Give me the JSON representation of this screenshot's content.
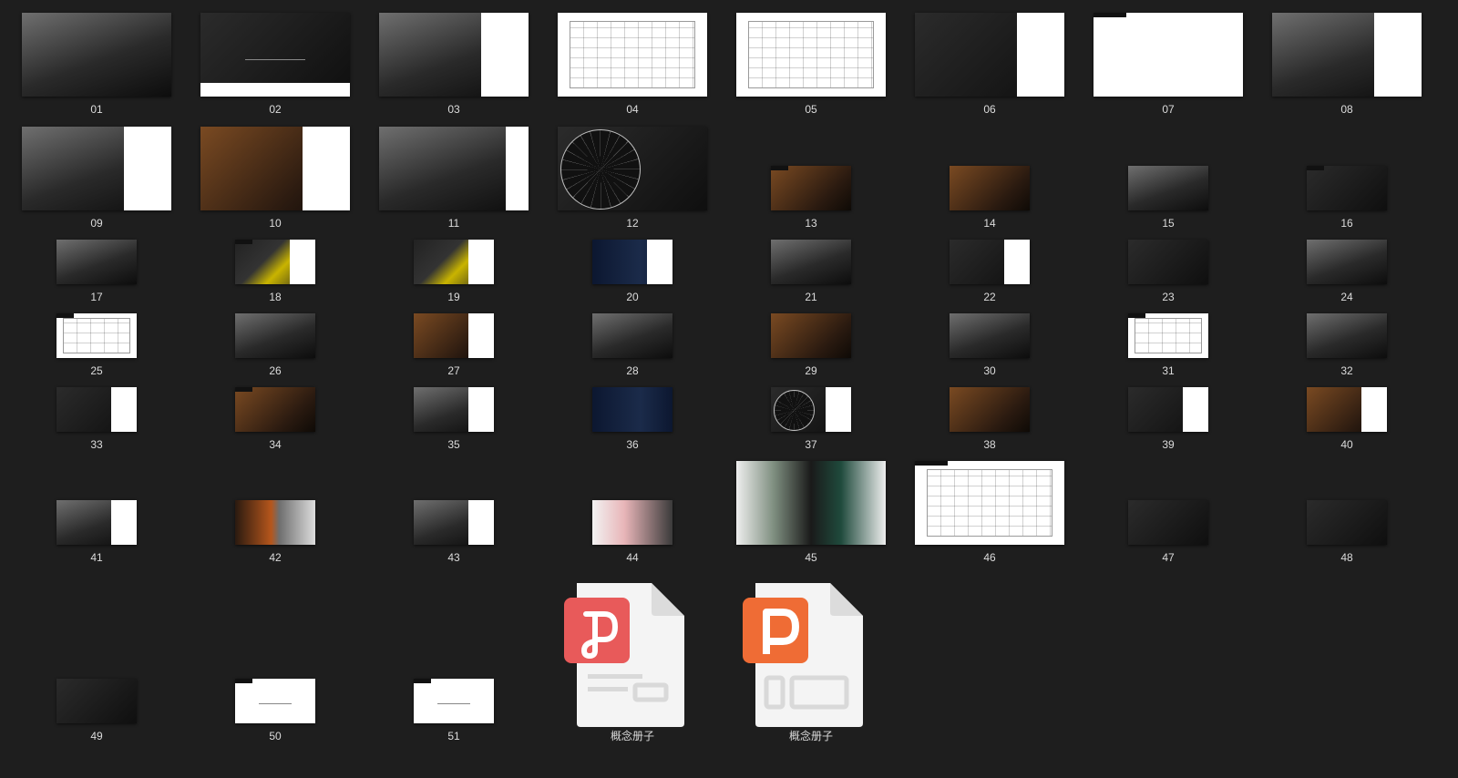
{
  "thumbnails": [
    {
      "label": "01",
      "style": "t-photo-bw",
      "size": "xl"
    },
    {
      "label": "02",
      "style": "t-dark",
      "size": "xl"
    },
    {
      "label": "03",
      "style": "t-photo-bw",
      "size": "xl"
    },
    {
      "label": "04",
      "style": "t-white",
      "size": "xl"
    },
    {
      "label": "05",
      "style": "t-white",
      "size": "xl"
    },
    {
      "label": "06",
      "style": "t-dark",
      "size": "xl"
    },
    {
      "label": "07",
      "style": "t-white",
      "size": "xl"
    },
    {
      "label": "08",
      "style": "t-photo-bw",
      "size": "xl"
    },
    {
      "label": "09",
      "style": "t-photo-bw",
      "size": "xl"
    },
    {
      "label": "10",
      "style": "t-warm",
      "size": "xl"
    },
    {
      "label": "11",
      "style": "t-photo-bw",
      "size": "xl"
    },
    {
      "label": "12",
      "style": "t-dark",
      "size": "xl"
    },
    {
      "label": "13",
      "style": "t-warm",
      "size": "md"
    },
    {
      "label": "14",
      "style": "t-warm",
      "size": "md"
    },
    {
      "label": "15",
      "style": "t-photo-bw",
      "size": "md"
    },
    {
      "label": "16",
      "style": "t-dark",
      "size": "md"
    },
    {
      "label": "17",
      "style": "t-photo-bw",
      "size": "md"
    },
    {
      "label": "18",
      "style": "t-yellow",
      "size": "md"
    },
    {
      "label": "19",
      "style": "t-yellow",
      "size": "md"
    },
    {
      "label": "20",
      "style": "t-navy",
      "size": "md"
    },
    {
      "label": "21",
      "style": "t-photo-bw",
      "size": "md"
    },
    {
      "label": "22",
      "style": "t-dark",
      "size": "md"
    },
    {
      "label": "23",
      "style": "t-dark",
      "size": "md"
    },
    {
      "label": "24",
      "style": "t-photo-bw",
      "size": "md"
    },
    {
      "label": "25",
      "style": "t-white",
      "size": "md"
    },
    {
      "label": "26",
      "style": "t-photo-bw",
      "size": "md"
    },
    {
      "label": "27",
      "style": "t-warm",
      "size": "md"
    },
    {
      "label": "28",
      "style": "t-photo-bw",
      "size": "md"
    },
    {
      "label": "29",
      "style": "t-warm",
      "size": "md"
    },
    {
      "label": "30",
      "style": "t-photo-bw",
      "size": "md"
    },
    {
      "label": "31",
      "style": "t-white",
      "size": "md"
    },
    {
      "label": "32",
      "style": "t-photo-bw",
      "size": "md"
    },
    {
      "label": "33",
      "style": "t-dark",
      "size": "md"
    },
    {
      "label": "34",
      "style": "t-warm",
      "size": "md"
    },
    {
      "label": "35",
      "style": "t-photo-bw",
      "size": "md"
    },
    {
      "label": "36",
      "style": "t-navy",
      "size": "md"
    },
    {
      "label": "37",
      "style": "t-dark",
      "size": "md"
    },
    {
      "label": "38",
      "style": "t-warm",
      "size": "md"
    },
    {
      "label": "39",
      "style": "t-dark",
      "size": "md"
    },
    {
      "label": "40",
      "style": "t-warm",
      "size": "md"
    },
    {
      "label": "41",
      "style": "t-photo-bw",
      "size": "md"
    },
    {
      "label": "42",
      "style": "t-orange",
      "size": "md"
    },
    {
      "label": "43",
      "style": "t-photo-bw",
      "size": "md"
    },
    {
      "label": "44",
      "style": "t-pink",
      "size": "md"
    },
    {
      "label": "45",
      "style": "t-green",
      "size": "xl"
    },
    {
      "label": "46",
      "style": "t-white",
      "size": "xl"
    },
    {
      "label": "47",
      "style": "t-dark",
      "size": "md"
    },
    {
      "label": "48",
      "style": "t-dark",
      "size": "md"
    },
    {
      "label": "49",
      "style": "t-dark",
      "size": "md"
    },
    {
      "label": "50",
      "style": "t-white",
      "size": "md"
    },
    {
      "label": "51",
      "style": "t-white",
      "size": "md"
    }
  ],
  "files": [
    {
      "label": "概念册子",
      "icon": "wps-presentation-icon",
      "badge_color": "#e85a5a",
      "badge_letter": "P"
    },
    {
      "label": "概念册子",
      "icon": "powerpoint-file-icon",
      "badge_color": "#ef6c35",
      "badge_letter": "P"
    }
  ]
}
